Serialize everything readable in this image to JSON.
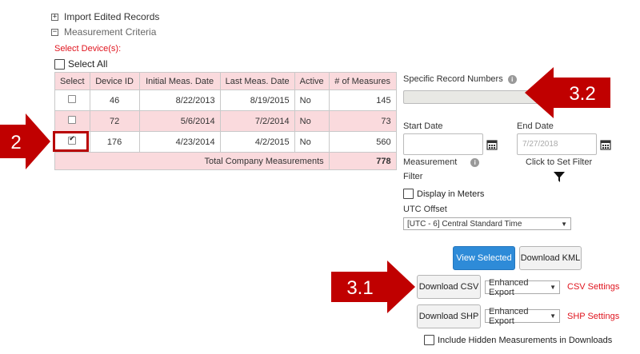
{
  "tree": {
    "import_label": "Import Edited Records",
    "import_toggle": "+",
    "criteria_label": "Measurement Criteria",
    "criteria_toggle": "−"
  },
  "devices": {
    "heading": "Select Device(s):",
    "select_all": "Select All",
    "columns": [
      "Select",
      "Device ID",
      "Initial Meas. Date",
      "Last Meas. Date",
      "Active",
      "# of Measures"
    ],
    "rows": [
      {
        "id": "46",
        "initial": "8/22/2013",
        "last": "8/19/2015",
        "active": "No",
        "measures": "145",
        "checked": false
      },
      {
        "id": "72",
        "initial": "5/6/2014",
        "last": "7/2/2014",
        "active": "No",
        "measures": "73",
        "checked": false
      },
      {
        "id": "176",
        "initial": "4/23/2014",
        "last": "4/2/2015",
        "active": "No",
        "measures": "560",
        "checked": true
      }
    ],
    "total_label": "Total Company Measurements",
    "total_value": "778"
  },
  "callouts": {
    "step2": "2",
    "step31": "3.1",
    "step32": "3.2",
    "color": "#c00000"
  },
  "filters": {
    "record_numbers_label": "Specific Record Numbers",
    "start_date_label": "Start Date",
    "start_date_value": "",
    "end_date_label": "End Date",
    "end_date_placeholder": "7/27/2018",
    "measurement_filter_label_1": "Measurement",
    "measurement_filter_label_2": "Filter",
    "set_filter_label": "Click to Set Filter",
    "meters_label": "Display in Meters",
    "utc_label": "UTC Offset",
    "utc_value": "[UTC - 6] Central Standard Time"
  },
  "actions": {
    "view_selected": "View Selected",
    "download_kml": "Download KML",
    "download_csv": "Download CSV",
    "csv_export": "Enhanced Export",
    "csv_settings": "CSV Settings",
    "download_shp": "Download SHP",
    "shp_export": "Enhanced Export",
    "shp_settings": "SHP Settings",
    "include_hidden": "Include Hidden Measurements in Downloads"
  },
  "colors": {
    "accent_red": "#e0141e",
    "table_pink": "#fadadd",
    "primary_blue": "#2e8bd8"
  },
  "icons": {
    "calendar": "calendar-icon",
    "info": "info-icon",
    "filter": "funnel-icon"
  }
}
